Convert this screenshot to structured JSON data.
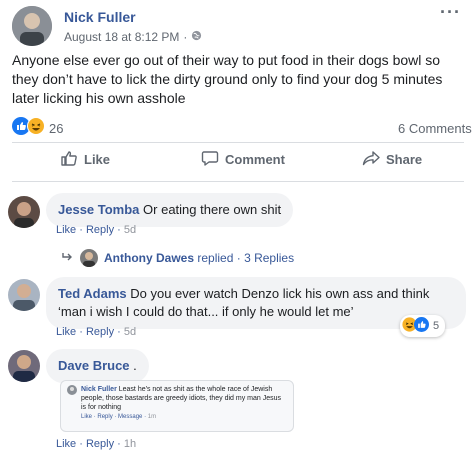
{
  "post": {
    "author": "Nick Fuller",
    "timestamp": "August 18 at 8:12 PM",
    "separator": "·",
    "text": "Anyone else ever go out of their way to put food in their dogs bowl so they don’t have to lick the dirty ground only to find your dog 5 minutes later licking his own asshole",
    "reaction_count": "26",
    "comment_count": "6 Comments",
    "menu": "···"
  },
  "actions": {
    "like": "Like",
    "comment": "Comment",
    "share": "Share"
  },
  "comments": [
    {
      "name": "Jesse Tomba",
      "text": "Or eating there own shit",
      "like": "Like",
      "reply": "Reply",
      "time": "5d",
      "dot": "·",
      "replies": {
        "author": "Anthony Dawes",
        "label": "replied",
        "count": "3 Replies",
        "dot": "·"
      }
    },
    {
      "name": "Ted Adams",
      "text": "Do you ever watch Denzo lick his own ass and think ‘man i wish I could do that... if only he would let me’",
      "like": "Like",
      "reply": "Reply",
      "time": "5d",
      "dot": "·",
      "reaction_count": "5"
    },
    {
      "name": "Dave Bruce",
      "text": ".",
      "like": "Like",
      "reply": "Reply",
      "time": "1h",
      "dot": "·",
      "attachment": {
        "name": "Nick Fuller",
        "text": "Least he's not as shit as the whole race of Jewish people, those bastards are greedy idiots, they did my man Jesus is for nothing",
        "like": "Like",
        "reply": "Reply",
        "message": "Message",
        "time": "1m",
        "dot": "·"
      }
    }
  ],
  "colors": {
    "link": "#385898",
    "like_blue": "#1877f2",
    "haha_yellow": "#f7b125",
    "muted": "#606770"
  },
  "icons": [
    "globe-icon",
    "like-reaction-icon",
    "haha-reaction-icon",
    "thumbs-up-icon",
    "comment-icon",
    "share-icon",
    "reply-arrow-icon",
    "more-options-icon"
  ]
}
